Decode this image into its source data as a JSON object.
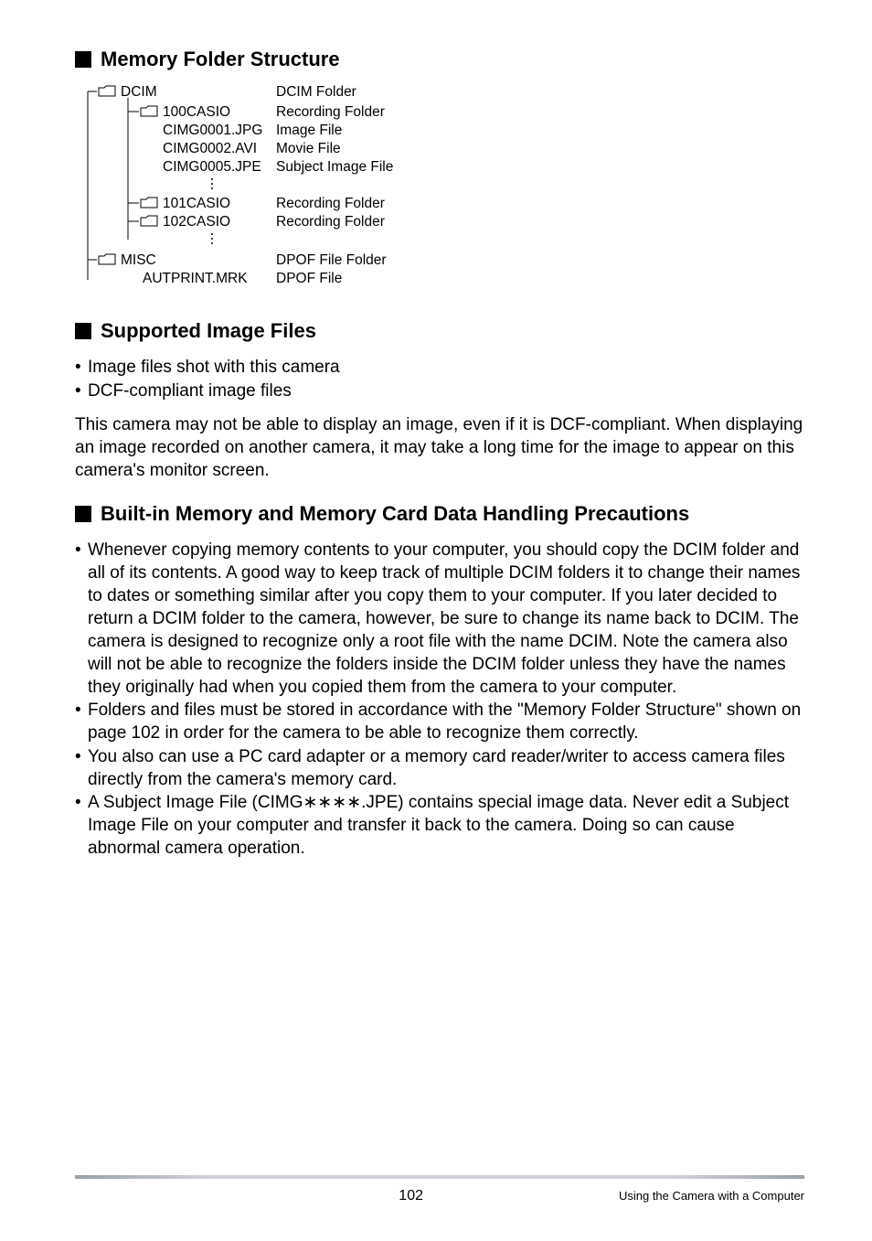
{
  "sections": {
    "memory": "Memory Folder Structure",
    "supported": "Supported Image Files",
    "builtin": "Built-in Memory and Memory Card Data Handling Precautions"
  },
  "tree": {
    "dcim": {
      "name": "DCIM",
      "desc": "DCIM Folder"
    },
    "f100": {
      "name": "100CASIO",
      "desc": "Recording Folder"
    },
    "cimg1": {
      "name": "CIMG0001.JPG",
      "desc": "Image File"
    },
    "cimg2": {
      "name": "CIMG0002.AVI",
      "desc": "Movie File"
    },
    "cimg5": {
      "name": "CIMG0005.JPE",
      "desc": "Subject Image File"
    },
    "f101": {
      "name": "101CASIO",
      "desc": "Recording Folder"
    },
    "f102": {
      "name": "102CASIO",
      "desc": "Recording Folder"
    },
    "misc": {
      "name": "MISC",
      "desc": "DPOF File Folder"
    },
    "autprint": {
      "name": "AUTPRINT.MRK",
      "desc": "DPOF File"
    }
  },
  "supported_list": [
    "Image files shot with this camera",
    "DCF-compliant image files"
  ],
  "supported_para": "This camera may not be able to display an image, even if it is DCF-compliant. When displaying an image recorded on another camera, it may take a long time for the image to appear on this camera's monitor screen.",
  "builtin_list": {
    "item1": "Whenever copying memory contents to your computer, you should copy the DCIM folder and all of its contents. A good way to keep track of multiple DCIM folders it to change their names to dates or something similar after you copy them to your computer. If you later decided to return a DCIM folder to the camera, however, be sure to change its name back to DCIM. The camera is designed to recognize only a root file with the name DCIM. Note the camera also will not be able to recognize the folders inside the DCIM folder unless they have the names they originally had when you copied them from the camera to your computer.",
    "item2": "Folders and files must be stored in accordance with the \"Memory Folder Structure\" shown on page 102 in order for the camera to be able to recognize them correctly.",
    "item3": "You also can use a PC card adapter or a memory card reader/writer to access camera files directly from the camera's memory card.",
    "item4a": "A Subject Image File (CIMG",
    "item4b": ".JPE) contains special image data. Never edit a Subject Image File on your computer and transfer it back to the camera. Doing so can cause abnormal camera operation."
  },
  "footer": {
    "page": "102",
    "label": "Using the Camera with a Computer"
  }
}
